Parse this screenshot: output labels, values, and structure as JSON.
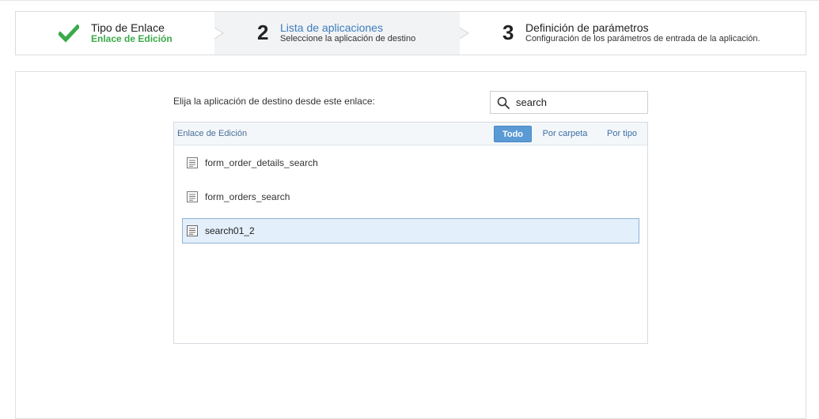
{
  "wizard": {
    "steps": [
      {
        "number": "",
        "title": "Tipo de Enlace",
        "subtitle": "Enlace de Edición"
      },
      {
        "number": "2",
        "title": "Lista de aplicaciones",
        "subtitle": "Seleccione la aplicación de destino"
      },
      {
        "number": "3",
        "title": "Definición de parámetros",
        "subtitle": "Configuración de los parámetros de entrada de la aplicación."
      }
    ]
  },
  "main": {
    "prompt": "Elija la aplicación de destino desde este enlace:",
    "search": {
      "value": "search",
      "icon": "search-icon"
    },
    "list": {
      "title": "Enlace de Edición",
      "filters": {
        "all": "Todo",
        "by_folder": "Por carpeta",
        "by_type": "Por tipo"
      },
      "items": [
        {
          "label": "form_order_details_search",
          "icon": "form-app-icon"
        },
        {
          "label": "form_orders_search",
          "icon": "form-app-icon"
        },
        {
          "label": "search01_2",
          "icon": "form-app-icon",
          "selected": true
        }
      ]
    }
  },
  "colors": {
    "accent_blue": "#3c7dbf",
    "done_green": "#3aaa4a",
    "active_filter": "#5a9bd5",
    "selected_row": "#e3effa"
  }
}
